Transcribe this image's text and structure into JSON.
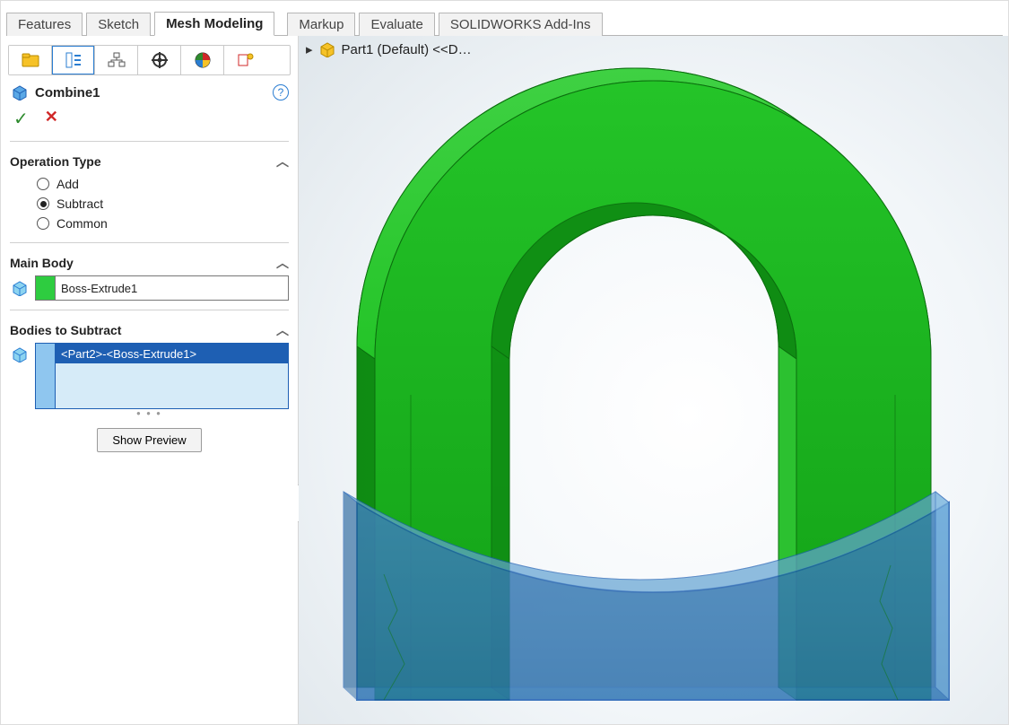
{
  "tabs_left": [
    "Features",
    "Sketch",
    "Mesh Modeling"
  ],
  "tabs_right": [
    "Markup",
    "Evaluate",
    "SOLIDWORKS Add-Ins"
  ],
  "active_tab": "Mesh Modeling",
  "breadcrumb": "Part1 (Default) <<D…",
  "feature": {
    "name": "Combine1",
    "help_tooltip": "Help",
    "ok_label": "OK",
    "cancel_label": "Cancel"
  },
  "operation_type": {
    "label": "Operation Type",
    "options": [
      "Add",
      "Subtract",
      "Common"
    ],
    "selected": "Subtract"
  },
  "main_body": {
    "label": "Main Body",
    "value": "Boss-Extrude1",
    "swatch_color": "#2ecc40"
  },
  "bodies_to_subtract": {
    "label": "Bodies to Subtract",
    "items": [
      "<Part2>-<Boss-Extrude1>"
    ],
    "swatch_color": "#8fc6ef",
    "sel_bg": "#1e5fb3"
  },
  "show_preview_label": "Show Preview",
  "colors": {
    "body_green": "#18b81c",
    "body_green_dark": "#0f8b13",
    "body_green_light": "#3fd143",
    "tool_blue": "#3b86c6",
    "tool_blue_dark": "#2d6aa0",
    "tool_blue_edge": "#1e5fb3"
  },
  "icons": {
    "tab1": "features-icon",
    "tab2": "tree-icon",
    "tab3": "hierarchy-icon",
    "tab4": "target-icon",
    "tab5": "appearance-icon",
    "tab6": "dim-icon"
  }
}
